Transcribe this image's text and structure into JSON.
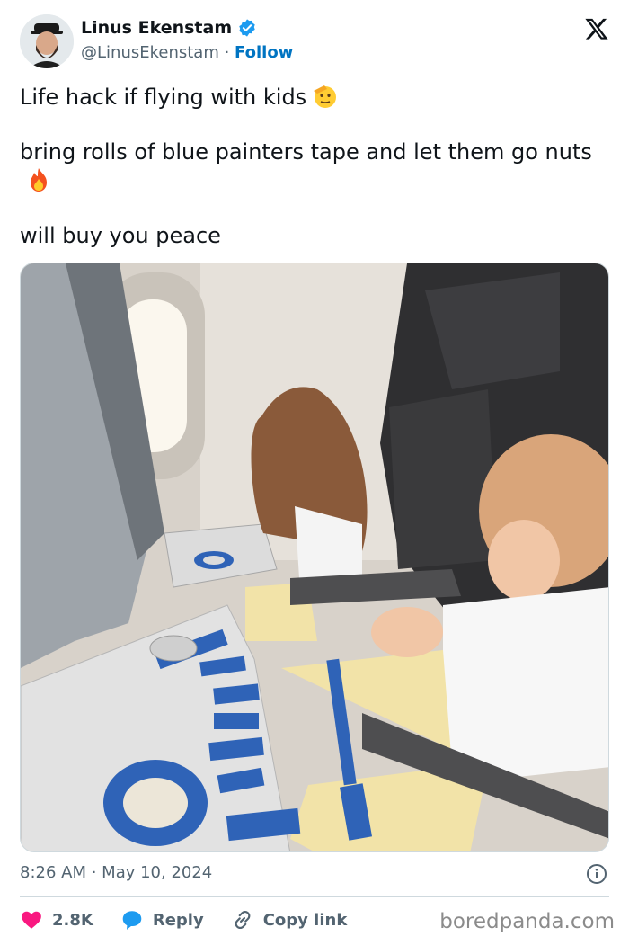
{
  "author": {
    "display_name": "Linus Ekenstam",
    "handle": "@LinusEkenstam",
    "separator": " · ",
    "follow_label": "Follow",
    "verified_color": "#1d9bf0"
  },
  "tweet": {
    "line1": "Life hack if flying with kids",
    "line1_emoji": "saluting-face",
    "line2": "bring rolls of blue painters tape and let them go nuts",
    "line2_emoji": "fire",
    "line3": "will buy you peace"
  },
  "photo": {
    "description_icon": "photo-two-kids-airplane-tape"
  },
  "meta": {
    "time": "8:26 AM",
    "separator": " · ",
    "date": "May 10, 2024"
  },
  "actions": {
    "likes_count": "2.8K",
    "reply_label": "Reply",
    "copy_link_label": "Copy link"
  },
  "watermark": "boredpanda.com",
  "colors": {
    "like": "#f91880",
    "reply": "#1d9bf0",
    "link": "#0074c2",
    "tape": "#2f63b7"
  }
}
